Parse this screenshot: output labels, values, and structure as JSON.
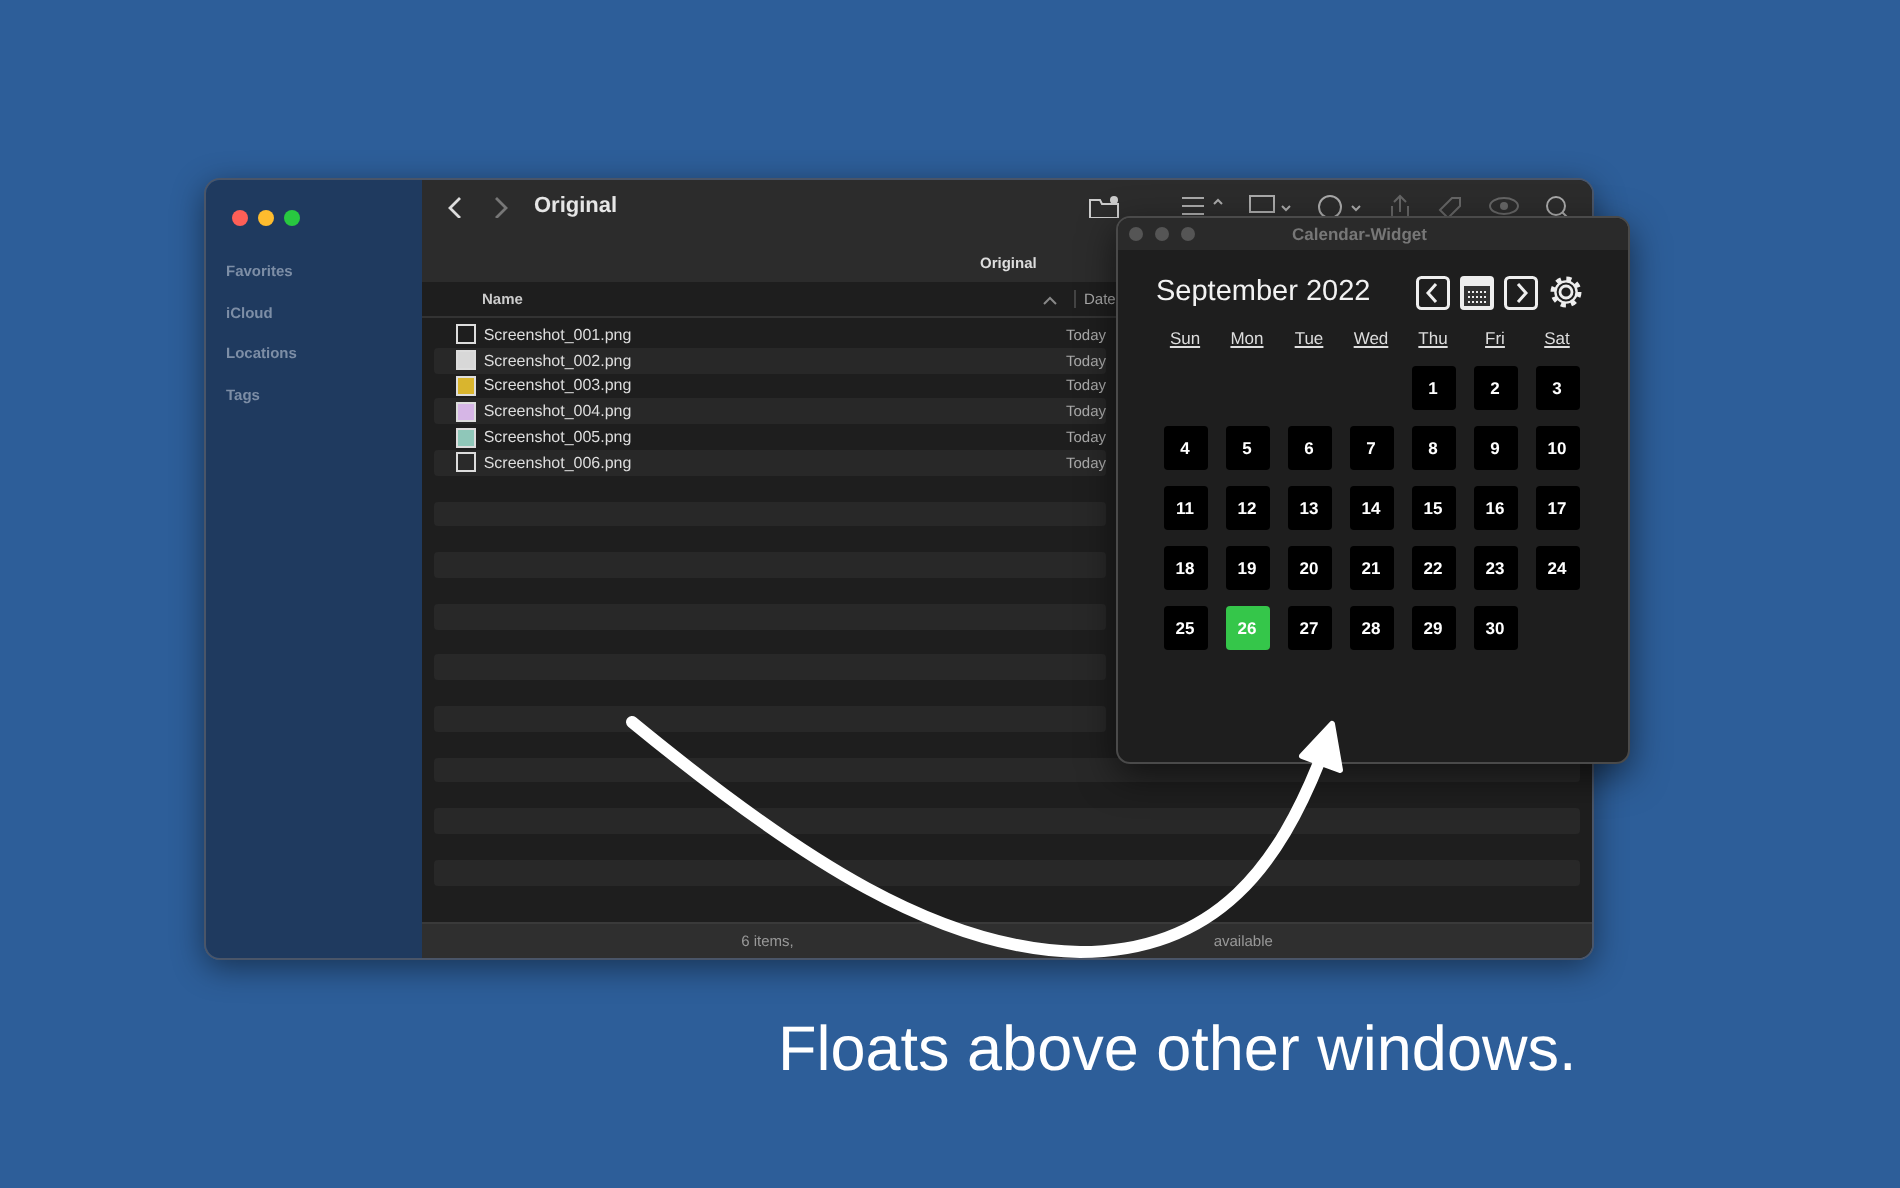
{
  "finder": {
    "sidebar": {
      "items": [
        {
          "label": "Favorites"
        },
        {
          "label": "iCloud"
        },
        {
          "label": "Locations"
        },
        {
          "label": "Tags"
        }
      ]
    },
    "title": "Original",
    "path_label": "Original",
    "columns": [
      "Name",
      "Date"
    ],
    "files": [
      {
        "name": "Screenshot_001.png",
        "date": "Today",
        "color": "#1e1e1e"
      },
      {
        "name": "Screenshot_002.png",
        "date": "Today",
        "color": "#d8d8d8"
      },
      {
        "name": "Screenshot_003.png",
        "date": "Today",
        "color": "#d9b52e"
      },
      {
        "name": "Screenshot_004.png",
        "date": "Today",
        "color": "#d6b6e6"
      },
      {
        "name": "Screenshot_005.png",
        "date": "Today",
        "color": "#8fc7b9"
      },
      {
        "name": "Screenshot_006.png",
        "date": "Today",
        "color": "#2a2a2a"
      }
    ],
    "status": [
      "6 items,",
      "available"
    ]
  },
  "calendar": {
    "title": "Calendar-Widget",
    "month": "September 2022",
    "weekdays": [
      "Sun",
      "Mon",
      "Tue",
      "Wed",
      "Thu",
      "Fri",
      "Sat"
    ],
    "weeks": [
      [
        {
          "day": "1",
          "today": false
        },
        {
          "day": "2",
          "today": false
        },
        {
          "day": "3",
          "today": false
        }
      ],
      [
        {
          "day": "4",
          "today": false
        },
        {
          "day": "5",
          "today": false
        },
        {
          "day": "6",
          "today": false
        },
        {
          "day": "7",
          "today": false
        },
        {
          "day": "8",
          "today": false
        },
        {
          "day": "9",
          "today": false
        },
        {
          "day": "10",
          "today": false
        }
      ],
      [
        {
          "day": "11",
          "today": false
        },
        {
          "day": "12",
          "today": false
        },
        {
          "day": "13",
          "today": false
        },
        {
          "day": "14",
          "today": false
        },
        {
          "day": "15",
          "today": false
        },
        {
          "day": "16",
          "today": false
        },
        {
          "day": "17",
          "today": false
        }
      ],
      [
        {
          "day": "18",
          "today": false
        },
        {
          "day": "19",
          "today": false
        },
        {
          "day": "20",
          "today": false
        },
        {
          "day": "21",
          "today": false
        },
        {
          "day": "22",
          "today": false
        },
        {
          "day": "23",
          "today": false
        },
        {
          "day": "24",
          "today": false
        }
      ],
      [
        {
          "day": "25",
          "today": false
        },
        {
          "day": "26",
          "today": true
        },
        {
          "day": "27",
          "today": false
        },
        {
          "day": "28",
          "today": false
        },
        {
          "day": "29",
          "today": false
        },
        {
          "day": "30",
          "today": false
        }
      ]
    ]
  },
  "caption": "Floats above other windows."
}
